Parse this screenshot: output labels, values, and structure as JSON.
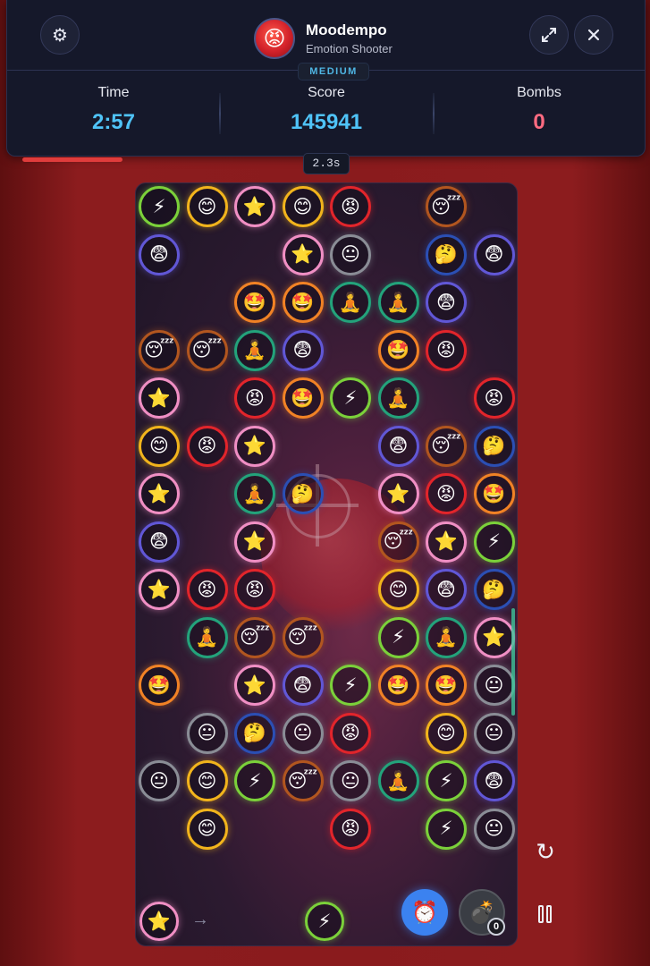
{
  "header": {
    "app_name": "Moodempo",
    "subtitle": "Emotion Shooter",
    "avatar_emoji": "😡",
    "difficulty": "MEDIUM",
    "settings_icon": "gear-icon",
    "fullscreen_icon": "expand-icon",
    "close_icon": "close-icon"
  },
  "stats": {
    "time_label": "Time",
    "time_value": "2:57",
    "score_label": "Score",
    "score_value": "145941",
    "bombs_label": "Bombs",
    "bombs_value": "0",
    "colors": {
      "time": "#4fc3f7",
      "score": "#4fc3f7",
      "bombs": "#ff6b81"
    }
  },
  "progress_fraction": 0.16,
  "shot_timer": "2.3s",
  "emotions": {
    "B": {
      "emoji": "⚡",
      "color": "#7bd13a",
      "name": "energy"
    },
    "H": {
      "emoji": "😊",
      "color": "#f2b41c",
      "name": "happy"
    },
    "S": {
      "emoji": "⭐",
      "color": "#f08fc4",
      "name": "star"
    },
    "A": {
      "emoji": "😡",
      "color": "#e2252b",
      "name": "angry"
    },
    "T": {
      "emoji": "😴",
      "color": "#b2561f",
      "name": "sleepy"
    },
    "F": {
      "emoji": "😨",
      "color": "#6157d6",
      "name": "fearful"
    },
    "N": {
      "emoji": "😐",
      "color": "#8a8d96",
      "name": "neutral"
    },
    "K": {
      "emoji": "🤔",
      "color": "#2b4fb4",
      "name": "thinking"
    },
    "W": {
      "emoji": "🤩",
      "color": "#f18225",
      "name": "starstruck"
    },
    "M": {
      "emoji": "🧘",
      "color": "#23a37b",
      "name": "meditate"
    }
  },
  "grid": [
    "BHSHA.T.",
    "F..SN.KF",
    "..WWMMF.",
    "TTMF.WA.",
    "S.AWBM.A",
    "HAS..FTK",
    "S.MK.SAW",
    "F.S..TSB",
    "SAA..HFK",
    ".MTT.BMS",
    "W.SFBWWN",
    ".NKNA.HN",
    "NHBTNMBF",
    ".H..A.BN"
  ],
  "shooter": {
    "next_bubble": "S",
    "current_bubble": "B",
    "arrow_icon": "arrow-right-icon"
  },
  "powerups": {
    "time_freeze_icon": "alarm-clock-icon",
    "time_freeze_emoji": "⏰",
    "bomb_icon": "bomb-icon",
    "bomb_emoji": "💣",
    "bomb_count": "0"
  },
  "controls": {
    "restart_icon": "restart-icon",
    "restart_glyph": "↻",
    "pause_icon": "pause-icon",
    "pause_glyph": "⏸"
  }
}
